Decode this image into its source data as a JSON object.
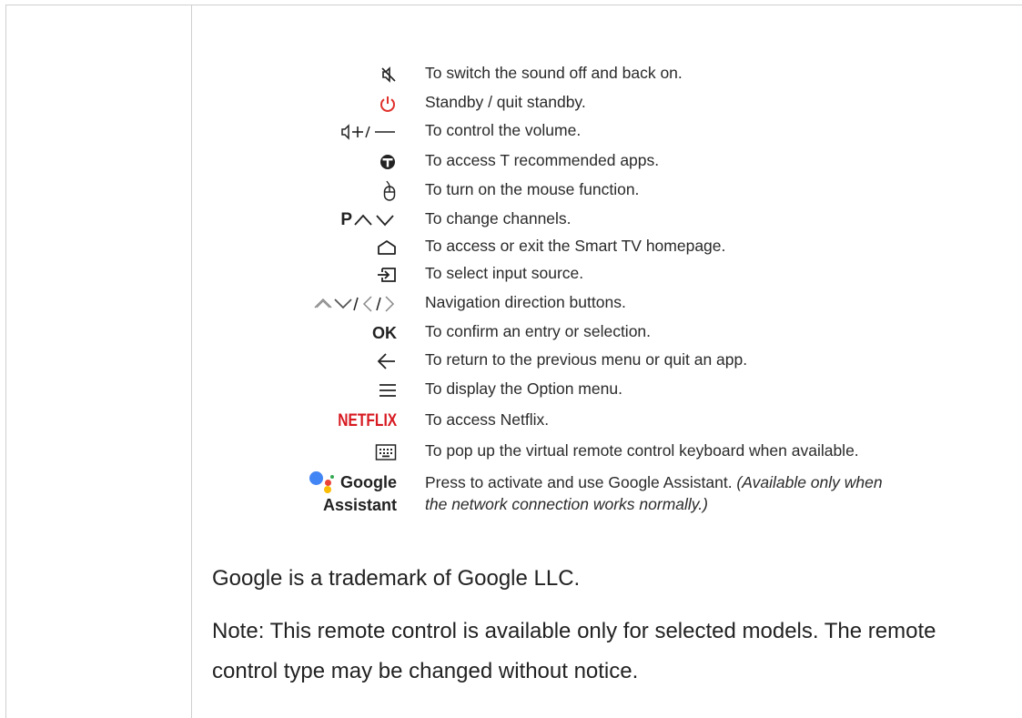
{
  "buttons": [
    {
      "icon": "mute-icon",
      "desc": "To switch the sound off and back on."
    },
    {
      "icon": "power-icon",
      "desc": "Standby / quit standby."
    },
    {
      "icon": "volume-icon",
      "desc": "To control the volume."
    },
    {
      "icon": "t-apps-icon",
      "desc": "To access T recommended apps."
    },
    {
      "icon": "mouse-icon",
      "desc": "To turn on the mouse function."
    },
    {
      "icon": "channel-icon",
      "label": "P",
      "desc": "To change channels."
    },
    {
      "icon": "home-icon",
      "desc": "To access or exit the Smart TV homepage."
    },
    {
      "icon": "input-source-icon",
      "desc": "To select input source."
    },
    {
      "icon": "navigation-arrows-icon",
      "desc": "Navigation direction buttons."
    },
    {
      "icon": "ok-label",
      "label": "OK",
      "desc": "To confirm an entry or selection."
    },
    {
      "icon": "back-arrow-icon",
      "desc": "To return to the previous menu or quit an app."
    },
    {
      "icon": "menu-icon",
      "desc": "To display the Option menu."
    },
    {
      "icon": "netflix-logo",
      "label": "NETFLIX",
      "desc": "To access Netflix."
    },
    {
      "icon": "keyboard-icon",
      "desc": "To pop up the virtual remote control keyboard when available."
    }
  ],
  "google_assistant": {
    "label_line1": "Google",
    "label_line2": "Assistant",
    "desc": "Press to activate and use Google Assistant. ",
    "desc_italic": "(Available only when the network connection works normally.)"
  },
  "colors": {
    "power": "#e0302a",
    "netflix": "#d71920",
    "google_blue": "#4285f4",
    "google_red": "#ea4335",
    "google_yellow": "#fbbc05",
    "google_green": "#34a853"
  },
  "trademark": "Google is a trademark of Google LLC.",
  "note": "Note: This remote control is available only for selected models. The remote control type may be changed without notice."
}
